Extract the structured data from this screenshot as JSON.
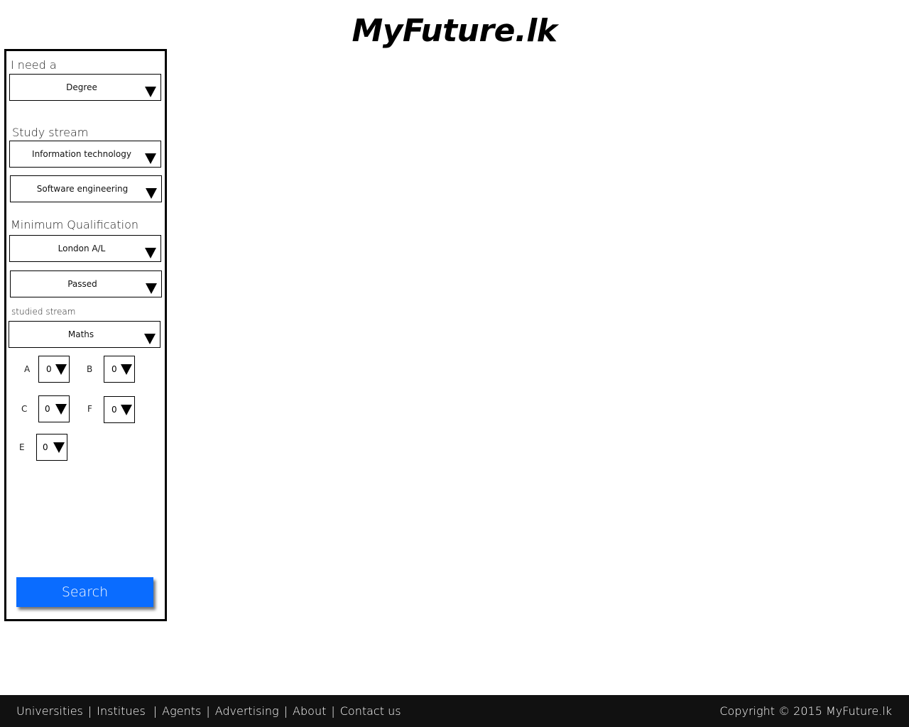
{
  "header": {
    "site_title": "MyFuture.lk"
  },
  "filter_panel": {
    "need_label": "I need a",
    "need_value": "Degree",
    "study_stream_label": "Study stream",
    "stream_value": "Information technology",
    "substream_value": "Software engineering",
    "min_qual_label": "Minimum Qualification",
    "qualification_value": "London A/L",
    "result_value": "Passed",
    "studied_stream_label": "studied stream",
    "studied_stream_value": "Maths",
    "grades": [
      {
        "label": "A",
        "value": "0"
      },
      {
        "label": "B",
        "value": "0"
      },
      {
        "label": "C",
        "value": "0"
      },
      {
        "label": "F",
        "value": "0"
      },
      {
        "label": "E",
        "value": "0"
      }
    ],
    "search_label": "Search"
  },
  "footer": {
    "links": [
      "Universities",
      "Institues",
      "Agents",
      "Advertising",
      "About",
      "Contact us"
    ],
    "separator": "|",
    "copyright": "Copyright © 2015 MyFuture.lk"
  },
  "colors": {
    "search_button": "#0a6cff",
    "footer_bg": "#111111"
  }
}
